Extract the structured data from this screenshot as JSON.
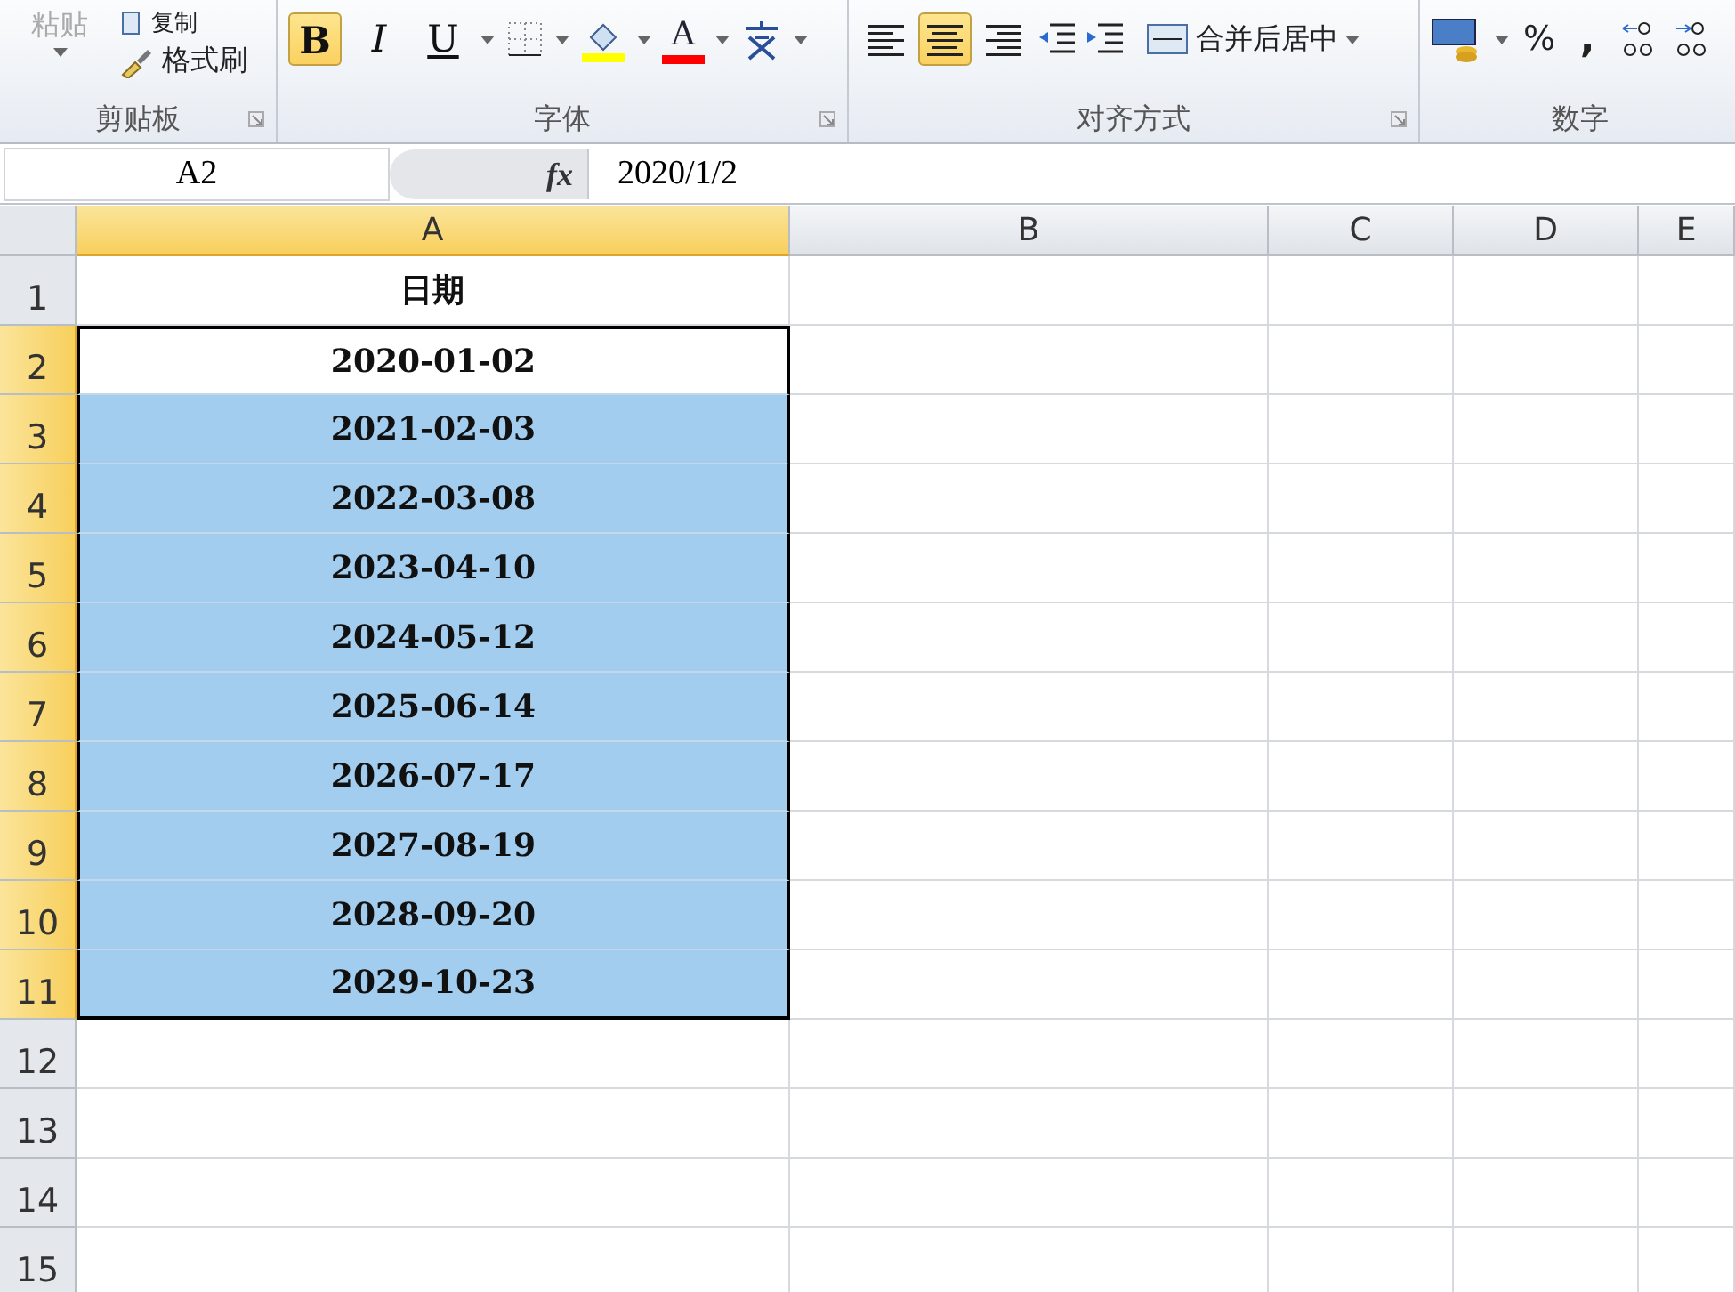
{
  "clipboard": {
    "label": "剪贴板",
    "paste": "粘贴",
    "copy": "复制",
    "format_painter": "格式刷"
  },
  "font": {
    "label": "字体",
    "styles": [
      {
        "kind": "bold",
        "label": "B",
        "selected": true
      },
      {
        "kind": "italic",
        "label": "I",
        "selected": false
      },
      {
        "kind": "underline",
        "label": "U",
        "selected": false
      }
    ],
    "font_color": "A"
  },
  "alignment": {
    "label": "对齐方式",
    "aligns": [
      {
        "kind": "left",
        "selected": false
      },
      {
        "kind": "center",
        "selected": true
      },
      {
        "kind": "right",
        "selected": false
      }
    ],
    "merge": "合并后居中"
  },
  "number": {
    "label": "数字",
    "percent": "%",
    "comma": ","
  },
  "formula_bar": {
    "name_box": "A2",
    "fx": "fx",
    "formula": "2020/1/2"
  },
  "columns": [
    {
      "label": "A",
      "selected": true
    },
    {
      "label": "B",
      "selected": false
    },
    {
      "label": "C",
      "selected": false
    },
    {
      "label": "D",
      "selected": false
    },
    {
      "label": "E",
      "selected": false
    }
  ],
  "rows": [
    {
      "number": "1",
      "value": "日期",
      "selected": false
    },
    {
      "number": "2",
      "value": "2020-01-02",
      "selected": true,
      "active": true
    },
    {
      "number": "3",
      "value": "2021-02-03",
      "selected": true
    },
    {
      "number": "4",
      "value": "2022-03-08",
      "selected": true
    },
    {
      "number": "5",
      "value": "2023-04-10",
      "selected": true
    },
    {
      "number": "6",
      "value": "2024-05-12",
      "selected": true
    },
    {
      "number": "7",
      "value": "2025-06-14",
      "selected": true
    },
    {
      "number": "8",
      "value": "2026-07-17",
      "selected": true
    },
    {
      "number": "9",
      "value": "2027-08-19",
      "selected": true
    },
    {
      "number": "10",
      "value": "2028-09-20",
      "selected": true
    },
    {
      "number": "11",
      "value": "2029-10-23",
      "selected": true
    },
    {
      "number": "12",
      "selected": false
    },
    {
      "number": "13",
      "selected": false
    },
    {
      "number": "14",
      "selected": false
    },
    {
      "number": "15",
      "selected": false
    }
  ]
}
